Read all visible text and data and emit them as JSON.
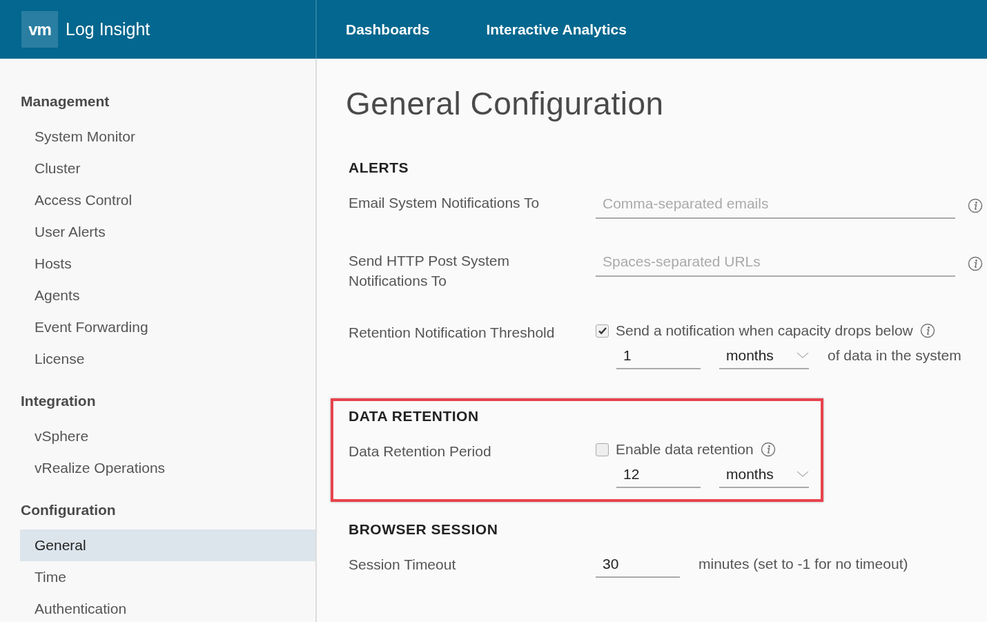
{
  "header": {
    "logo": "vm",
    "app_name": "Log Insight",
    "nav": [
      {
        "label": "Dashboards",
        "selected": false
      },
      {
        "label": "Interactive Analytics",
        "selected": false
      }
    ]
  },
  "sidebar": {
    "groups": [
      {
        "title": "Management",
        "items": [
          {
            "label": "System Monitor",
            "selected": false
          },
          {
            "label": "Cluster",
            "selected": false
          },
          {
            "label": "Access Control",
            "selected": false
          },
          {
            "label": "User Alerts",
            "selected": false
          },
          {
            "label": "Hosts",
            "selected": false
          },
          {
            "label": "Agents",
            "selected": false
          },
          {
            "label": "Event Forwarding",
            "selected": false
          },
          {
            "label": "License",
            "selected": false
          }
        ]
      },
      {
        "title": "Integration",
        "items": [
          {
            "label": "vSphere",
            "selected": false
          },
          {
            "label": "vRealize Operations",
            "selected": false
          }
        ]
      },
      {
        "title": "Configuration",
        "items": [
          {
            "label": "General",
            "selected": true
          },
          {
            "label": "Time",
            "selected": false
          },
          {
            "label": "Authentication",
            "selected": false
          }
        ]
      }
    ]
  },
  "page_title": "General Configuration",
  "sections": [
    {
      "title": "ALERTS",
      "highlighted": false,
      "rows": [
        {
          "kind": "text",
          "label": "Email System Notifications To",
          "placeholder": "Comma-separated emails",
          "info": true
        },
        {
          "kind": "text",
          "label": "Send HTTP Post System Notifications To",
          "placeholder": "Spaces-separated URLs",
          "info": true
        },
        {
          "kind": "check_period",
          "label": "Retention Notification Threshold",
          "checked": true,
          "check_label": "Send a notification when capacity drops below",
          "info": true,
          "value": "1",
          "unit": "months",
          "suffix": "of data in the system"
        }
      ]
    },
    {
      "title": "DATA RETENTION",
      "highlighted": true,
      "rows": [
        {
          "kind": "check_period",
          "label": "Data Retention Period",
          "checked": false,
          "check_label": "Enable data retention",
          "info": true,
          "value": "12",
          "unit": "months"
        }
      ]
    },
    {
      "title": "BROWSER SESSION",
      "highlighted": false,
      "rows": [
        {
          "kind": "number",
          "label": "Session Timeout",
          "value": "30",
          "suffix": "minutes (set to -1 for no timeout)"
        }
      ]
    }
  ]
}
